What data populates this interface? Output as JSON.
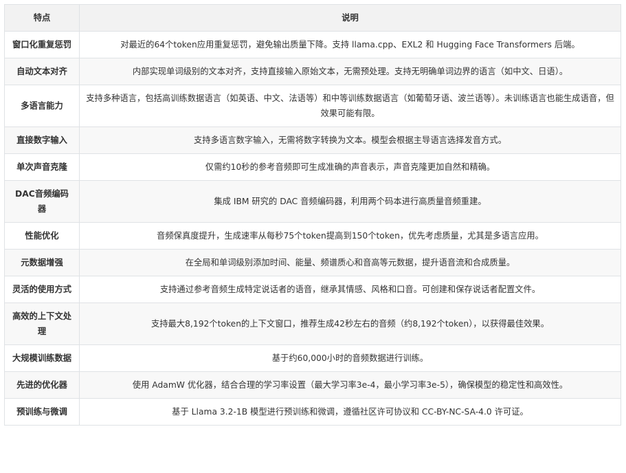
{
  "header": {
    "feature": "特点",
    "description": "说明"
  },
  "rows": [
    {
      "feature": "窗口化重复惩罚",
      "description": "对最近的64个token应用重复惩罚，避免输出质量下降。支持 llama.cpp、EXL2 和 Hugging Face Transformers 后端。"
    },
    {
      "feature": "自动文本对齐",
      "description": "内部实现单词级别的文本对齐，支持直接输入原始文本，无需预处理。支持无明确单词边界的语言（如中文、日语）。"
    },
    {
      "feature": "多语言能力",
      "description": "支持多种语言，包括高训练数据语言（如英语、中文、法语等）和中等训练数据语言（如葡萄牙语、波兰语等）。未训练语言也能生成语音，但效果可能有限。"
    },
    {
      "feature": "直接数字输入",
      "description": "支持多语言数字输入，无需将数字转换为文本。模型会根据主导语言选择发音方式。"
    },
    {
      "feature": "单次声音克隆",
      "description": "仅需约10秒的参考音频即可生成准确的声音表示，声音克隆更加自然和精确。"
    },
    {
      "feature": "DAC音频编码器",
      "description": "集成 IBM 研究的 DAC 音频编码器，利用两个码本进行高质量音频重建。"
    },
    {
      "feature": "性能优化",
      "description": "音频保真度提升，生成速率从每秒75个token提高到150个token，优先考虑质量，尤其是多语言应用。"
    },
    {
      "feature": "元数据增强",
      "description": "在全局和单词级别添加时间、能量、频谱质心和音高等元数据，提升语音流和合成质量。"
    },
    {
      "feature": "灵活的使用方式",
      "description": "支持通过参考音频生成特定说话者的语音，继承其情感、风格和口音。可创建和保存说话者配置文件。"
    },
    {
      "feature": "高效的上下文处理",
      "description": "支持最大8,192个token的上下文窗口，推荐生成42秒左右的音频（约8,192个token），以获得最佳效果。"
    },
    {
      "feature": "大规模训练数据",
      "description": "基于约60,000小时的音频数据进行训练。"
    },
    {
      "feature": "先进的优化器",
      "description": "使用 AdamW 优化器，结合合理的学习率设置（最大学习率3e-4，最小学习率3e-5），确保模型的稳定性和高效性。"
    },
    {
      "feature": "预训练与微调",
      "description": "基于 Llama 3.2-1B 模型进行预训练和微调，遵循社区许可协议和 CC-BY-NC-SA-4.0 许可证。"
    }
  ]
}
